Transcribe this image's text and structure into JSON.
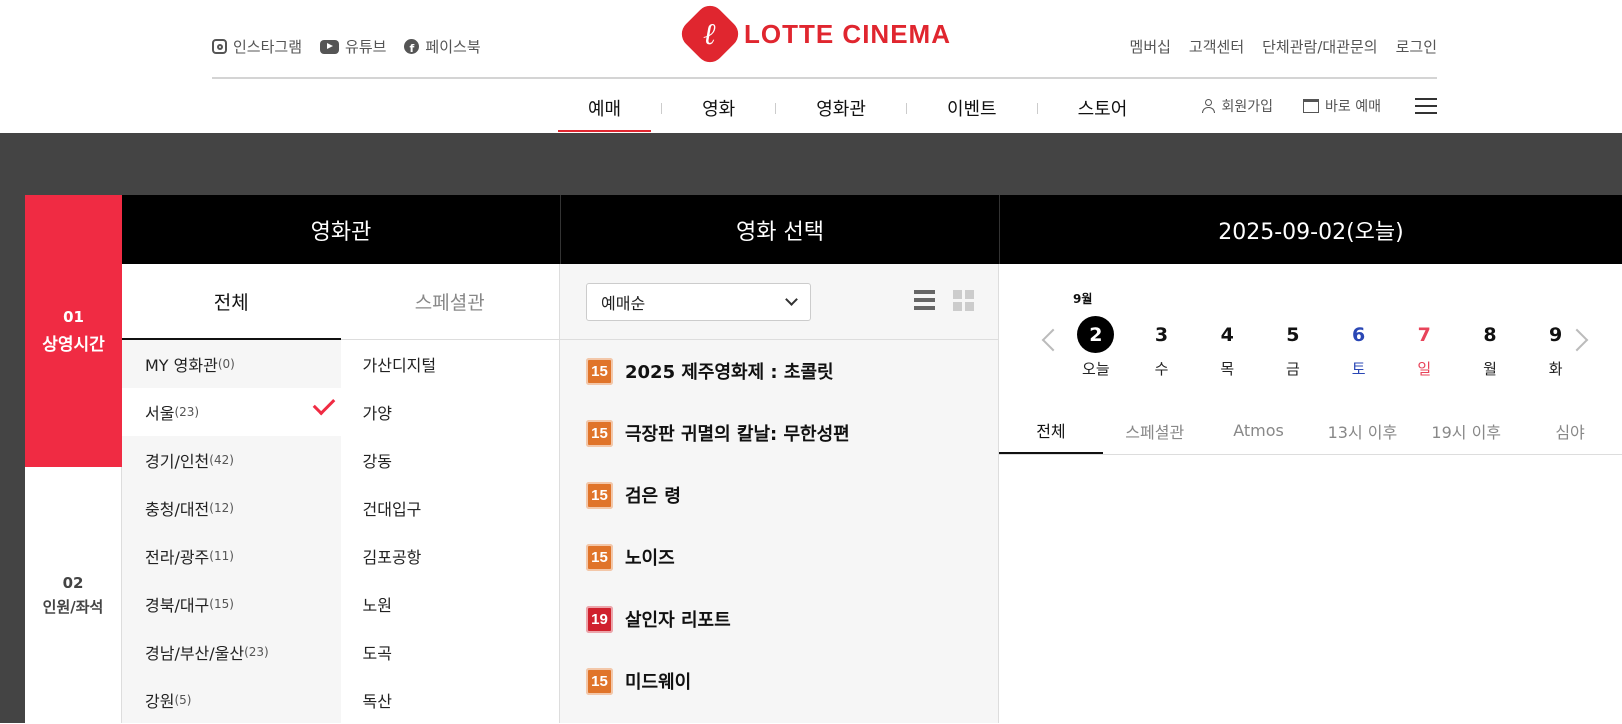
{
  "header": {
    "social": [
      {
        "label": "인스타그램",
        "icon": "instagram-icon"
      },
      {
        "label": "유튜브",
        "icon": "youtube-icon"
      },
      {
        "label": "페이스북",
        "icon": "facebook-icon"
      }
    ],
    "logo_text": "LOTTE CINEMA",
    "util": [
      "멤버십",
      "고객센터",
      "단체관람/대관문의",
      "로그인"
    ],
    "gnb": [
      "예매",
      "영화",
      "영화관",
      "이벤트",
      "스토어"
    ],
    "quick": {
      "signup": "회원가입",
      "quick_booking": "바로 예매"
    }
  },
  "steps": [
    {
      "num": "01",
      "label": "상영시간"
    },
    {
      "num": "02",
      "label": "인원/좌석"
    }
  ],
  "columns": {
    "cinema": "영화관",
    "movie": "영화 선택",
    "date": "2025-09-02(오늘)"
  },
  "cinema": {
    "tabs": [
      "전체",
      "스페셜관"
    ],
    "regions": [
      {
        "name": "MY 영화관",
        "count": "(0)"
      },
      {
        "name": "서울",
        "count": "(23)"
      },
      {
        "name": "경기/인천",
        "count": "(42)"
      },
      {
        "name": "충청/대전",
        "count": "(12)"
      },
      {
        "name": "전라/광주",
        "count": "(11)"
      },
      {
        "name": "경북/대구",
        "count": "(15)"
      },
      {
        "name": "경남/부산/울산",
        "count": "(23)"
      },
      {
        "name": "강원",
        "count": "(5)"
      }
    ],
    "theaters": [
      "가산디지털",
      "가양",
      "강동",
      "건대입구",
      "김포공항",
      "노원",
      "도곡",
      "독산"
    ]
  },
  "movie": {
    "sort": "예매순",
    "list": [
      {
        "rating": "15",
        "title": "2025 제주영화제 : 초콜릿"
      },
      {
        "rating": "15",
        "title": "극장판 귀멸의 칼날: 무한성편"
      },
      {
        "rating": "15",
        "title": "검은 령"
      },
      {
        "rating": "15",
        "title": "노이즈"
      },
      {
        "rating": "19",
        "title": "살인자 리포트"
      },
      {
        "rating": "15",
        "title": "미드웨이"
      }
    ]
  },
  "schedule": {
    "month": "9월",
    "dates": [
      {
        "num": "2",
        "day": "오늘"
      },
      {
        "num": "3",
        "day": "수"
      },
      {
        "num": "4",
        "day": "목"
      },
      {
        "num": "5",
        "day": "금"
      },
      {
        "num": "6",
        "day": "토"
      },
      {
        "num": "7",
        "day": "일"
      },
      {
        "num": "8",
        "day": "월"
      },
      {
        "num": "9",
        "day": "화"
      }
    ],
    "tabs": [
      "전체",
      "스페셜관",
      "Atmos",
      "13시 이후",
      "19시 이후",
      "심야"
    ]
  },
  "colors": {
    "brand": "#e0262f",
    "step_active": "#f02b43",
    "rating_15": "#e0742a",
    "rating_19": "#d0202d",
    "saturday": "#2a47b5",
    "sunday": "#e8445a"
  }
}
